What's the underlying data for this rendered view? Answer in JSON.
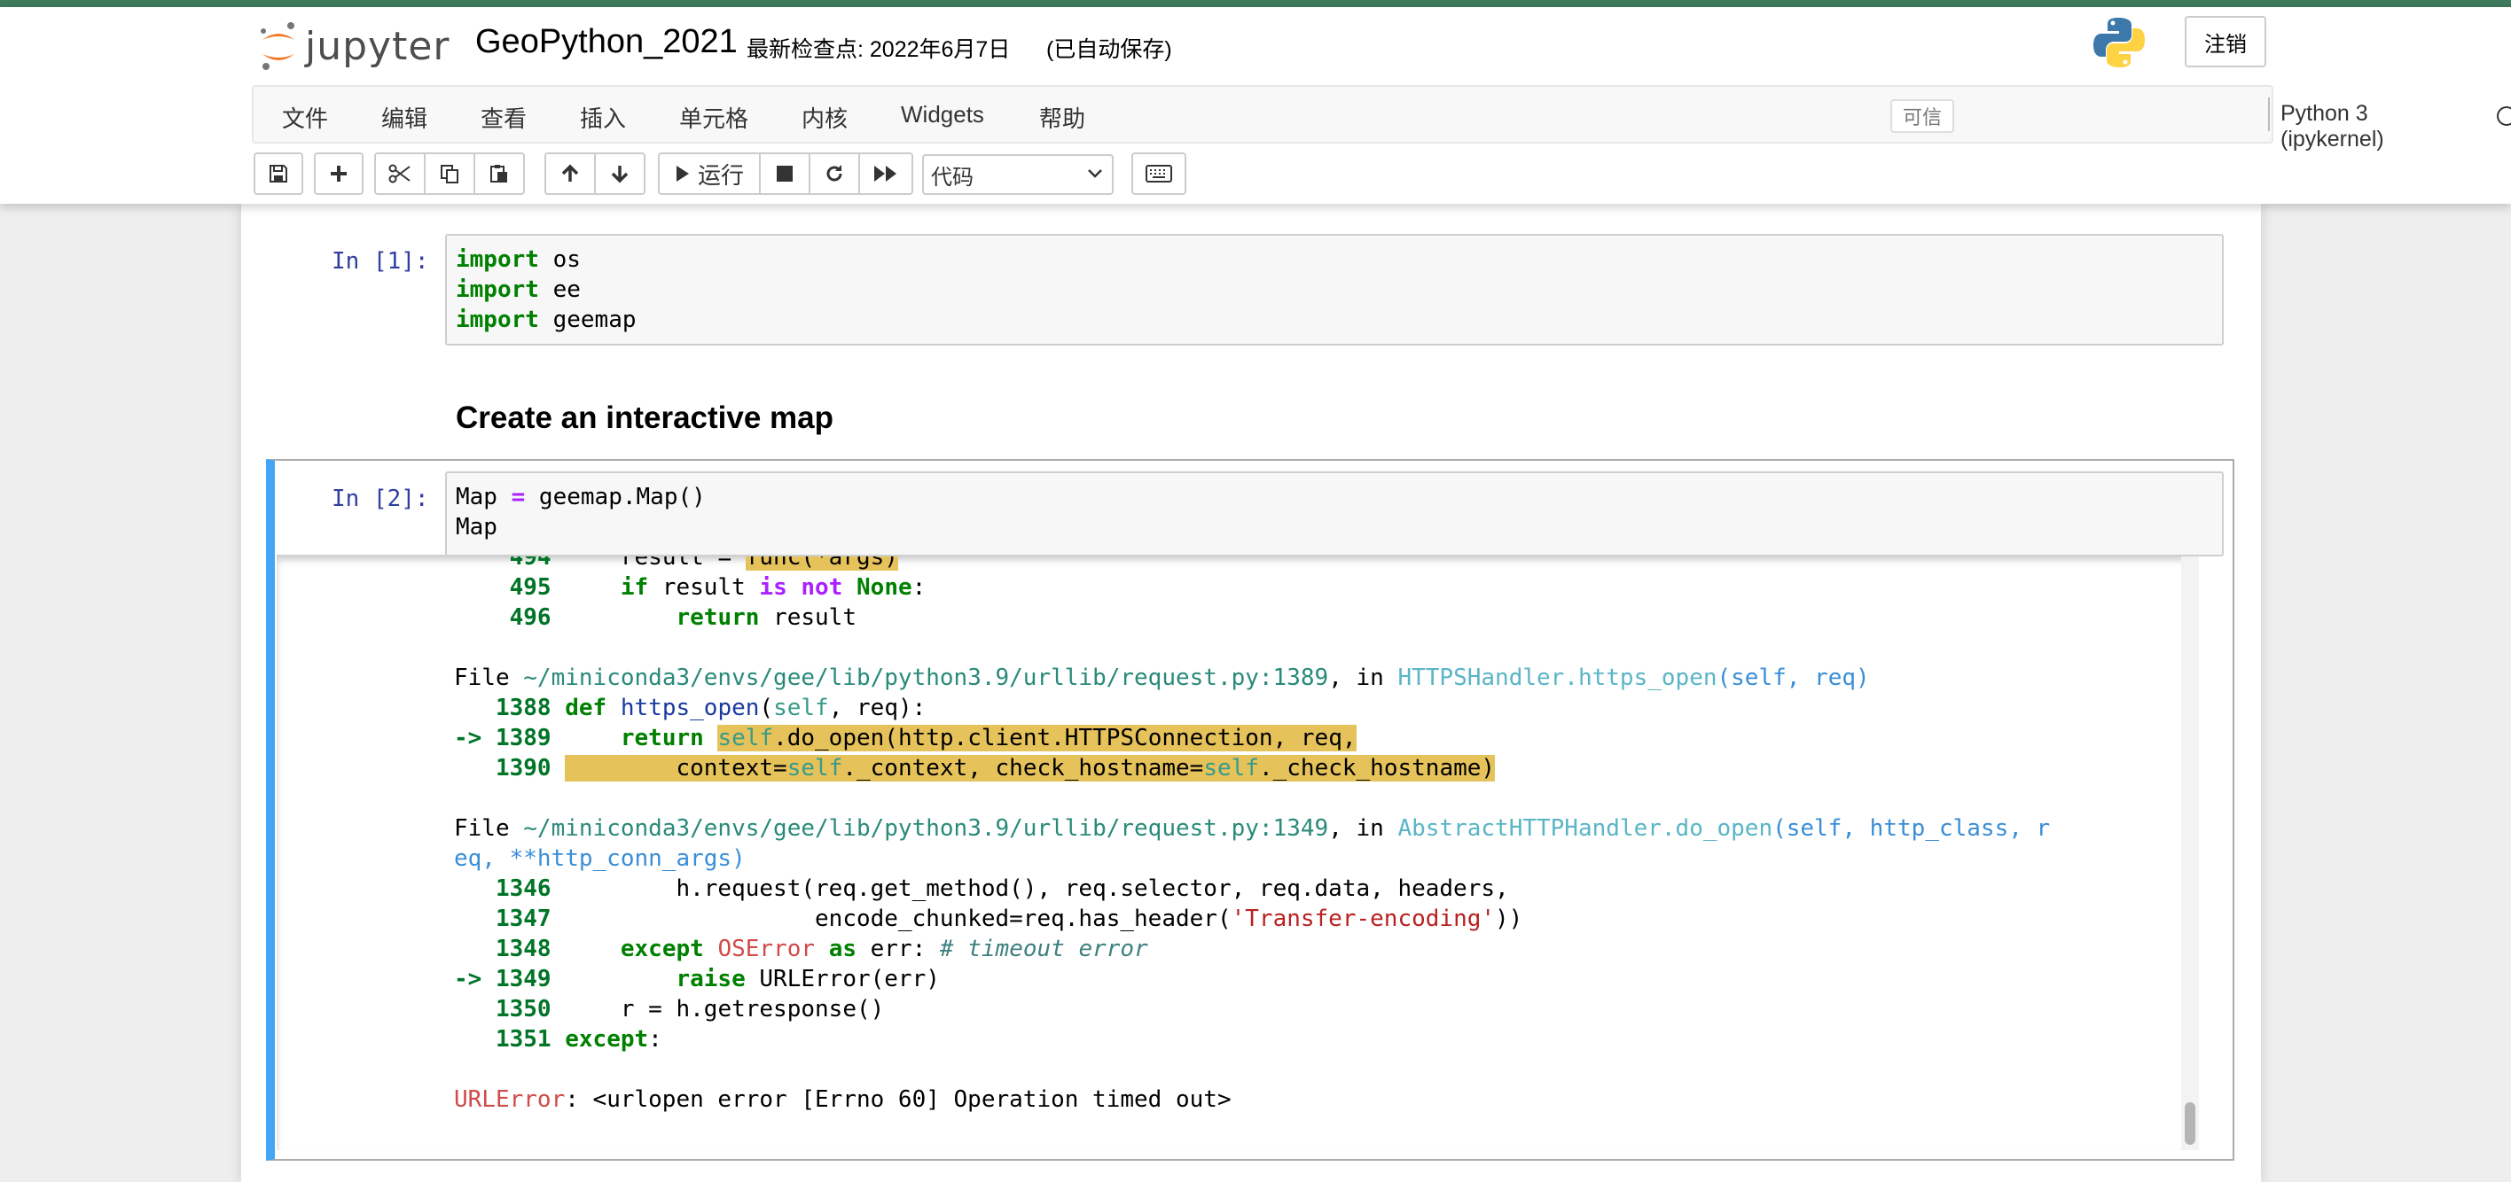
{
  "header": {
    "logo_text": "jupyter",
    "notebook_name": "GeoPython_2021",
    "checkpoint": "最新检查点: 2022年6月7日",
    "autosave": "(已自动保存)",
    "logout_label": "注销"
  },
  "menu": {
    "items": [
      "文件",
      "编辑",
      "查看",
      "插入",
      "单元格",
      "内核",
      "Widgets",
      "帮助"
    ],
    "trusted_label": "可信",
    "kernel_name": "Python 3 (ipykernel)"
  },
  "toolbar": {
    "run_label": "运行",
    "cell_type": "代码"
  },
  "cells": {
    "cell1": {
      "prompt": "In [1]:"
    },
    "markdown": {
      "heading": "Create an interactive map"
    },
    "cell2": {
      "prompt": "In [2]:"
    }
  },
  "colors": {
    "accent": "#42a5f5",
    "prompt": "#303f9f",
    "highlight": "#e5c25a"
  }
}
